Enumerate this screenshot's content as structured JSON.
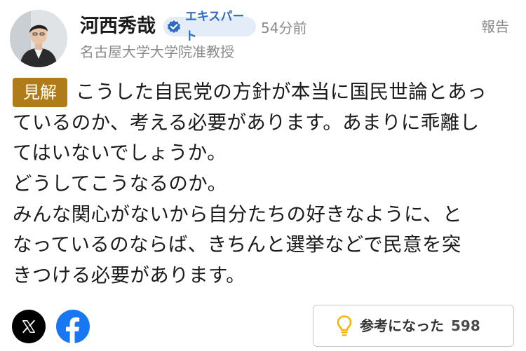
{
  "author": {
    "name": "河西秀哉",
    "badge": "エキスパート",
    "time_ago": "54分前",
    "affiliation": "名古屋大学大学院准教授"
  },
  "report_label": "報告",
  "comment": {
    "tag": "見解",
    "lines": [
      "こうした自民党の方針が本当に国民世論とあっ",
      "ているのか、考える必要があります。あまりに乖離し",
      "てはいないでしょうか。",
      "どうしてこうなるのか。",
      "みんな関心がないから自分たちの好きなように、と",
      "なっているのならば、きちんと選挙などで民意を突",
      "きつける必要があります。"
    ]
  },
  "actions": {
    "share_icons": [
      "x-logo-icon",
      "facebook-icon"
    ],
    "helpful_label": "参考になった",
    "helpful_count": "598"
  },
  "colors": {
    "tag_background": "#b07c1a",
    "badge_background": "#e4ecf8",
    "badge_text": "#2f6ac2",
    "facebook_blue": "#1877f2",
    "bulb_yellow": "#f2b705",
    "muted_text": "#8a8a8a"
  }
}
